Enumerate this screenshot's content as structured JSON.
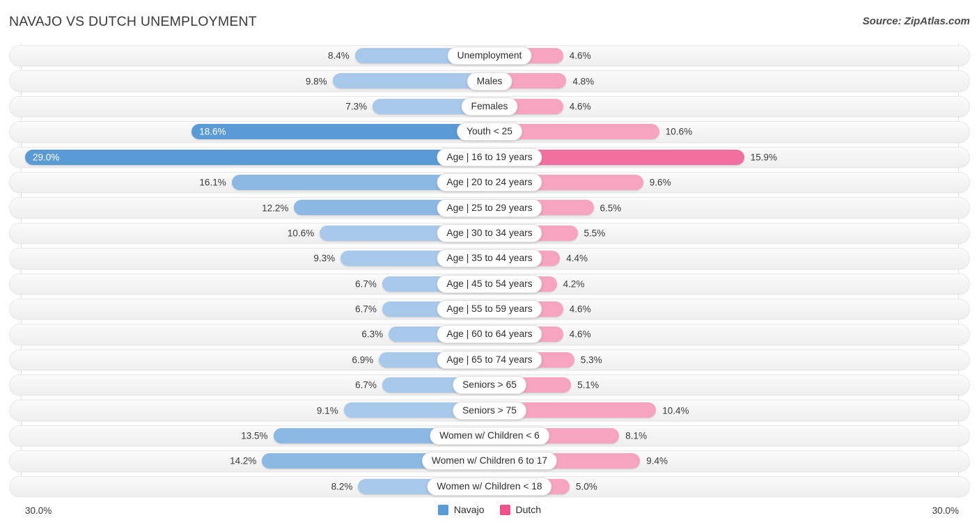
{
  "header": {
    "title": "NAVAJO VS DUTCH UNEMPLOYMENT",
    "source": "Source: ZipAtlas.com"
  },
  "axis": {
    "left_label": "30.0%",
    "right_label": "30.0%",
    "max": 30.0
  },
  "legend": {
    "items": [
      {
        "label": "Navajo",
        "color": "#5b9bd5"
      },
      {
        "label": "Dutch",
        "color": "#f0528c"
      }
    ]
  },
  "colors": {
    "navajo_light": "#a9c9ea",
    "navajo_mid": "#8cb8e4",
    "navajo_dark": "#5b9bd5",
    "dutch_light": "#f7a4c0",
    "dutch_mid": "#f2709f",
    "dutch_dark": "#ee4d88",
    "track_bg": "#f4f4f4",
    "title_color": "#3a3a3a"
  },
  "chart_data": {
    "type": "bar",
    "orientation": "horizontal-diverging",
    "title": "NAVAJO VS DUTCH UNEMPLOYMENT",
    "xlabel": "",
    "ylabel": "",
    "xlim": [
      30.0,
      30.0
    ],
    "grid": true,
    "legend_position": "bottom-center",
    "unit": "%",
    "categories": [
      "Unemployment",
      "Males",
      "Females",
      "Youth < 25",
      "Age | 16 to 19 years",
      "Age | 20 to 24 years",
      "Age | 25 to 29 years",
      "Age | 30 to 34 years",
      "Age | 35 to 44 years",
      "Age | 45 to 54 years",
      "Age | 55 to 59 years",
      "Age | 60 to 64 years",
      "Age | 65 to 74 years",
      "Seniors > 65",
      "Seniors > 75",
      "Women w/ Children < 6",
      "Women w/ Children 6 to 17",
      "Women w/ Children < 18"
    ],
    "series": [
      {
        "name": "Navajo",
        "side": "left",
        "color": "#5b9bd5",
        "values": [
          8.4,
          9.8,
          7.3,
          18.6,
          29.0,
          16.1,
          12.2,
          10.6,
          9.3,
          6.7,
          6.7,
          6.3,
          6.9,
          6.7,
          9.1,
          13.5,
          14.2,
          8.2
        ],
        "labels": [
          "8.4%",
          "9.8%",
          "7.3%",
          "18.6%",
          "29.0%",
          "16.1%",
          "12.2%",
          "10.6%",
          "9.3%",
          "6.7%",
          "6.7%",
          "6.3%",
          "6.9%",
          "6.7%",
          "9.1%",
          "13.5%",
          "14.2%",
          "8.2%"
        ]
      },
      {
        "name": "Dutch",
        "side": "right",
        "color": "#f0528c",
        "values": [
          4.6,
          4.8,
          4.6,
          10.6,
          15.9,
          9.6,
          6.5,
          5.5,
          4.4,
          4.2,
          4.6,
          4.6,
          5.3,
          5.1,
          10.4,
          8.1,
          9.4,
          5.0
        ],
        "labels": [
          "4.6%",
          "4.8%",
          "4.6%",
          "10.6%",
          "15.9%",
          "9.6%",
          "6.5%",
          "5.5%",
          "4.4%",
          "4.2%",
          "4.6%",
          "4.6%",
          "5.3%",
          "5.1%",
          "10.4%",
          "8.1%",
          "9.4%",
          "5.0%"
        ]
      }
    ]
  }
}
